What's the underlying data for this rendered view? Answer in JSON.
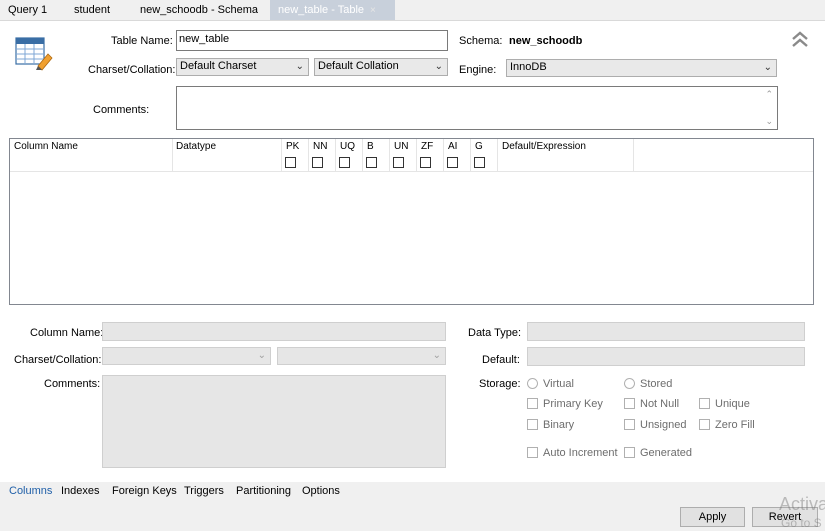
{
  "tabs": [
    {
      "label": "Query 1"
    },
    {
      "label": "student"
    },
    {
      "label": "new_schoodb - Schema"
    },
    {
      "label": "new_table - Table",
      "close": "×"
    }
  ],
  "table_name_label": "Table Name:",
  "table_name_value": "new_table",
  "schema_label": "Schema:",
  "schema_value": "new_schoodb",
  "charset_label": "Charset/Collation:",
  "charset_value": "Default Charset",
  "collation_value": "Default Collation",
  "engine_label": "Engine:",
  "engine_value": "InnoDB",
  "comments_label": "Comments:",
  "grid": {
    "columns": {
      "name": "Column Name",
      "datatype": "Datatype",
      "pk": "PK",
      "nn": "NN",
      "uq": "UQ",
      "b": "B",
      "un": "UN",
      "zf": "ZF",
      "ai": "AI",
      "g": "G",
      "default": "Default/Expression"
    }
  },
  "detail": {
    "column_name_label": "Column Name:",
    "charset_label": "Charset/Collation:",
    "comments_label": "Comments:",
    "data_type_label": "Data Type:",
    "default_label": "Default:",
    "storage_label": "Storage:",
    "virtual": "Virtual",
    "stored": "Stored",
    "primary_key": "Primary Key",
    "not_null": "Not Null",
    "unique": "Unique",
    "binary": "Binary",
    "unsigned": "Unsigned",
    "zero_fill": "Zero Fill",
    "auto_increment": "Auto Increment",
    "generated": "Generated"
  },
  "bottom_tabs": [
    "Columns",
    "Indexes",
    "Foreign Keys",
    "Triggers",
    "Partitioning",
    "Options"
  ],
  "buttons": {
    "apply": "Apply",
    "revert": "Revert"
  },
  "watermark": {
    "line1": "Activa",
    "line2": "Go to S"
  },
  "colors": {
    "active_tab": "#c8d0db",
    "active_bottom_tab": "#1f5fa8"
  }
}
